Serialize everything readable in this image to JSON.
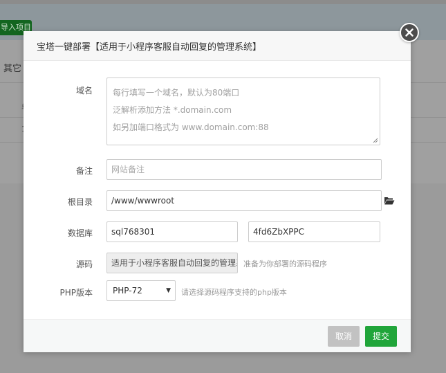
{
  "background": {
    "import_button_label": "导入项目",
    "tab_other_label": "其它",
    "table_header_fragment": "单",
    "table_cell_fragment": "1"
  },
  "modal": {
    "title": "宝塔一键部署【适用于小程序客服自动回复的管理系统】",
    "close_icon": "close-icon",
    "form": {
      "domain": {
        "label": "域名",
        "placeholder_lines": [
          "每行填写一个域名，默认为80端口",
          "泛解析添加方法 *.domain.com",
          "如另加端口格式为 www.domain.com:88"
        ]
      },
      "remark": {
        "label": "备注",
        "placeholder": "网站备注"
      },
      "root_dir": {
        "label": "根目录",
        "value": "/www/wwwroot",
        "icon": "folder-open-icon"
      },
      "database": {
        "label": "数据库",
        "db_name": "sql768301",
        "db_password": "4fd6ZbXPPC"
      },
      "source": {
        "label": "源码",
        "value": "适用于小程序客服自动回复的管理系统",
        "hint": "准备为你部署的源码程序"
      },
      "php": {
        "label": "PHP版本",
        "selected": "PHP-72",
        "hint": "请选择源码程序支持的php版本"
      }
    },
    "footer": {
      "cancel_label": "取消",
      "submit_label": "提交"
    }
  },
  "colors": {
    "accent_green": "#20a53a",
    "cancel_gray": "#c2c2c2",
    "overlay_gray": "#9b9b9b"
  }
}
